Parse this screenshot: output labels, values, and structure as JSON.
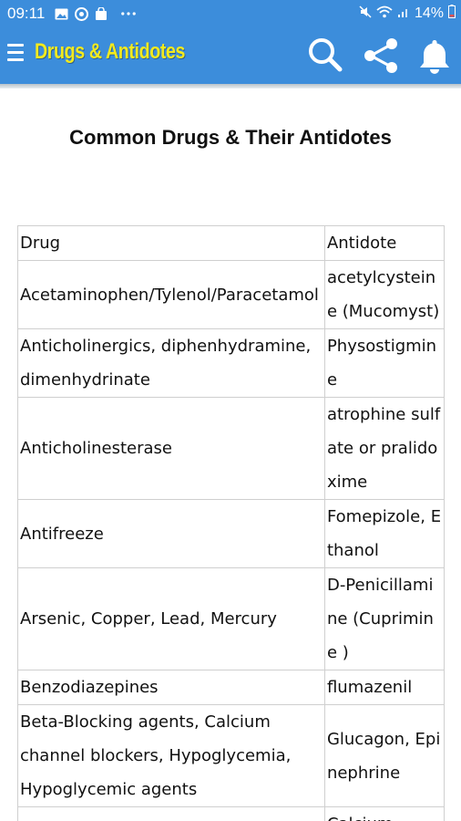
{
  "status_bar": {
    "time": "09:11",
    "battery": "14%",
    "icons": [
      "image-icon",
      "sync-icon",
      "bag-icon",
      "more-dots-icon",
      "silent-icon",
      "wifi-icon",
      "signal-icon",
      "battery-icon"
    ]
  },
  "app_bar": {
    "title": "Drugs & Antidotes",
    "accent_color": "#3c8ddb",
    "title_color": "#f2ea1e",
    "actions": [
      "search-icon",
      "share-icon",
      "bell-icon"
    ]
  },
  "page": {
    "heading": "Common Drugs & Their Antidotes"
  },
  "table": {
    "headers": {
      "drug": "Drug",
      "antidote": "Antidote"
    },
    "rows": [
      {
        "drug": "Acetaminophen/Tylenol/Paracetamol",
        "antidote": "acetylcysteine (Mucomyst)"
      },
      {
        "drug": "Anticholinergics, diphenhydramine, dimenhydrinate",
        "antidote": "Physostigmine"
      },
      {
        "drug": "Anticholinesterase",
        "antidote": "atrophine sulfate or pralidoxime"
      },
      {
        "drug": "Antifreeze",
        "antidote": "Fomepizole, Ethanol"
      },
      {
        "drug": "Arsenic, Copper, Lead, Mercury",
        "antidote": "D-Penicillamine (Cuprimine )"
      },
      {
        "drug": "Benzodiazepines",
        "antidote": "flumazenil"
      },
      {
        "drug": "Beta-Blocking agents, Calcium channel blockers, Hypoglycemia, Hypoglycemic agents",
        "antidote": "Glucagon, Epinephrine"
      },
      {
        "drug": "",
        "antidote": "Calcium"
      }
    ]
  }
}
